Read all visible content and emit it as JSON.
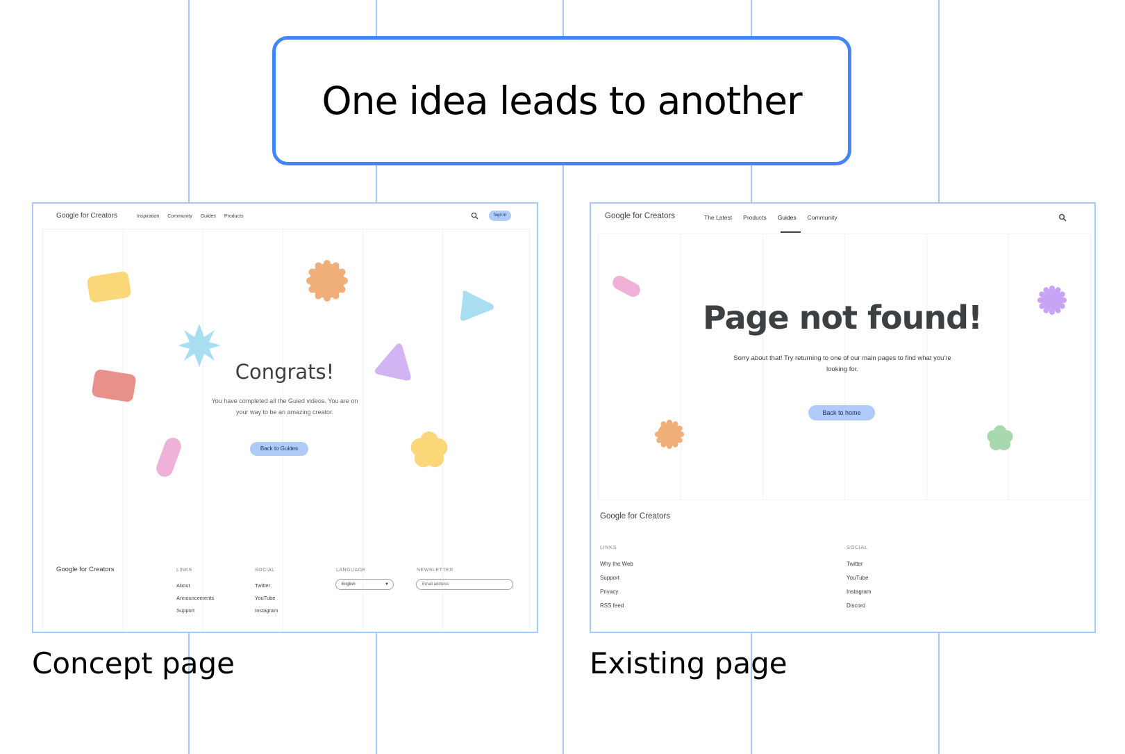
{
  "headline": "One idea leads to another",
  "colors": {
    "accent": "#4285f4",
    "grid_line": "#a8c7fa",
    "button": "#aecbfa"
  },
  "concept": {
    "caption": "Concept page",
    "brand": "Google for Creators",
    "nav": [
      "Inspiration",
      "Community",
      "Guides",
      "Products"
    ],
    "sign_in": "Sign in",
    "title": "Congrats!",
    "message_line1": "You have completed all the Guied videos. You are on",
    "message_line2": "your way to be an amazing creator.",
    "button": "Back to Guides",
    "footer": {
      "brand": "Google for Creators",
      "links_heading": "LINKS",
      "links": [
        "About",
        "Announcements",
        "Support"
      ],
      "social_heading": "SOCIAL",
      "social": [
        "Twitter",
        "YouTube",
        "Instagram"
      ],
      "language_heading": "LANGUAGE",
      "language_value": "English",
      "newsletter_heading": "NEWSLETTER",
      "email_placeholder": "Email address"
    }
  },
  "existing": {
    "caption": "Existing page",
    "brand": "Google for Creators",
    "nav": [
      "The Latest",
      "Products",
      "Guides",
      "Community"
    ],
    "active_nav": "Guides",
    "title": "Page not found!",
    "message_line1": "Sorry about that! Try returning to one of our main pages to find what you're",
    "message_line2": "looking for.",
    "button": "Back to home",
    "footer": {
      "brand": "Google for Creators",
      "links_heading": "LINKS",
      "links": [
        "Why the Web",
        "Support",
        "Privacy",
        "RSS feed"
      ],
      "social_heading": "SOCIAL",
      "social": [
        "Twitter",
        "YouTube",
        "Instagram",
        "Discord"
      ]
    }
  }
}
